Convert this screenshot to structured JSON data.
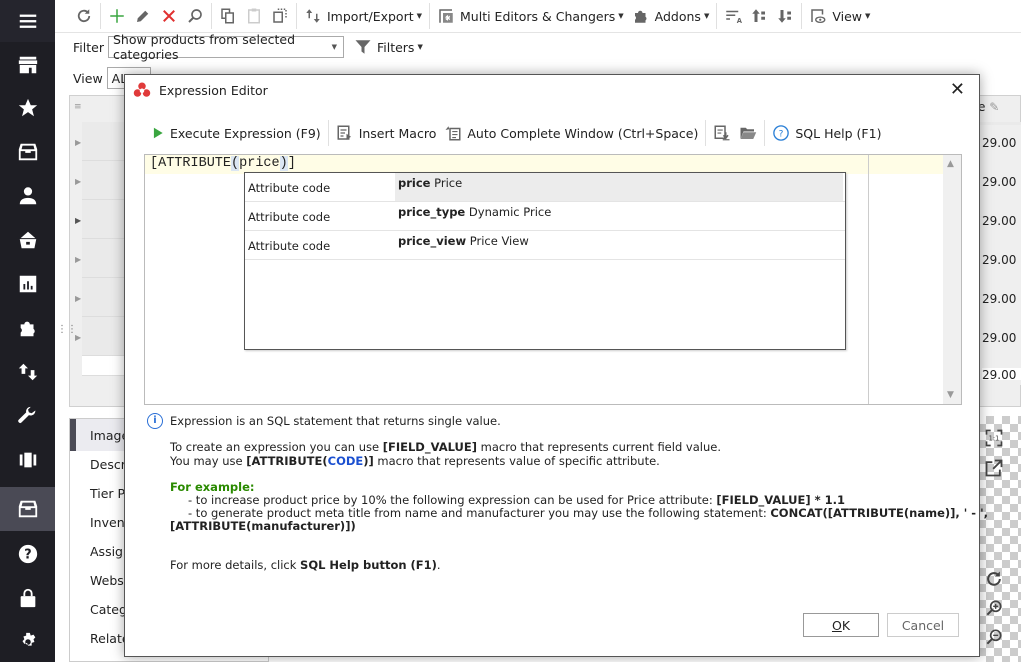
{
  "toolbar": {
    "import_export": "Import/Export",
    "multi_editors": "Multi Editors & Changers",
    "addons": "Addons",
    "view": "View"
  },
  "filter": {
    "label": "Filter",
    "value": "Show products from selected categories",
    "filters_button": "Filters"
  },
  "view_row": {
    "label": "View",
    "value": "ALL"
  },
  "background": {
    "price_header": "e",
    "price_values": [
      "29.00",
      "29.00",
      "29.00",
      "29.00",
      "29.00",
      "29.00",
      "29.00"
    ],
    "tabs": [
      "Images",
      "Descrip",
      "Tier Pri",
      "Invento",
      "Assign",
      "Websit",
      "Catego",
      "Relate"
    ]
  },
  "dialog": {
    "title": "Expression Editor",
    "toolbar": {
      "execute": "Execute Expression (F9)",
      "insert_macro": "Insert Macro",
      "auto_complete": "Auto Complete Window (Ctrl+Space)",
      "sql_help": "SQL Help (F1)"
    },
    "editor": {
      "code_prefix": "[ATTRIBUTE",
      "code_open": "(",
      "code_arg": "price",
      "code_close": ")",
      "code_suffix": "]"
    },
    "autocomplete": [
      {
        "kind": "Attribute code",
        "code": "price",
        "label": "Price",
        "selected": true
      },
      {
        "kind": "Attribute code",
        "code": "price_type",
        "label": "Dynamic Price",
        "selected": false
      },
      {
        "kind": "Attribute code",
        "code": "price_view",
        "label": "Price View",
        "selected": false
      }
    ],
    "help": {
      "line1": "Expression is an SQL statement that returns single value.",
      "line2_a": "To create an expression you can use ",
      "line2_b": "[FIELD_VALUE]",
      "line2_c": " macro that represents current field value.",
      "line3_a": "You may use ",
      "line3_b": "[ATTRIBUTE(",
      "line3_code": "CODE",
      "line3_c": ")]",
      "line3_d": " macro that represents value of specific attribute.",
      "example_title": "For example:",
      "ex1_a": "- to increase product price by 10% the following expression can be used for Price attribute: ",
      "ex1_b": "[FIELD_VALUE] * 1.1",
      "ex2_a": "- to generate product meta title from name and manufacturer you may use the following statement: ",
      "ex2_b": "CONCAT([ATTRIBUTE(name)], ' - ',",
      "ex2_c": "[ATTRIBUTE(manufacturer)])",
      "more_a": "For more details, click ",
      "more_b": "SQL Help button (F1)",
      "more_c": "."
    },
    "ok_label": "OK",
    "ok_mnemonic": "O",
    "ok_rest": "K",
    "cancel_label": "Cancel"
  },
  "colors": {
    "nav_bg": "#1e1e24",
    "nav_active": "#4a4a55",
    "editor_current_line": "#fffde6",
    "example_green": "#2a8a00",
    "code_blue": "#1a4fd0"
  }
}
